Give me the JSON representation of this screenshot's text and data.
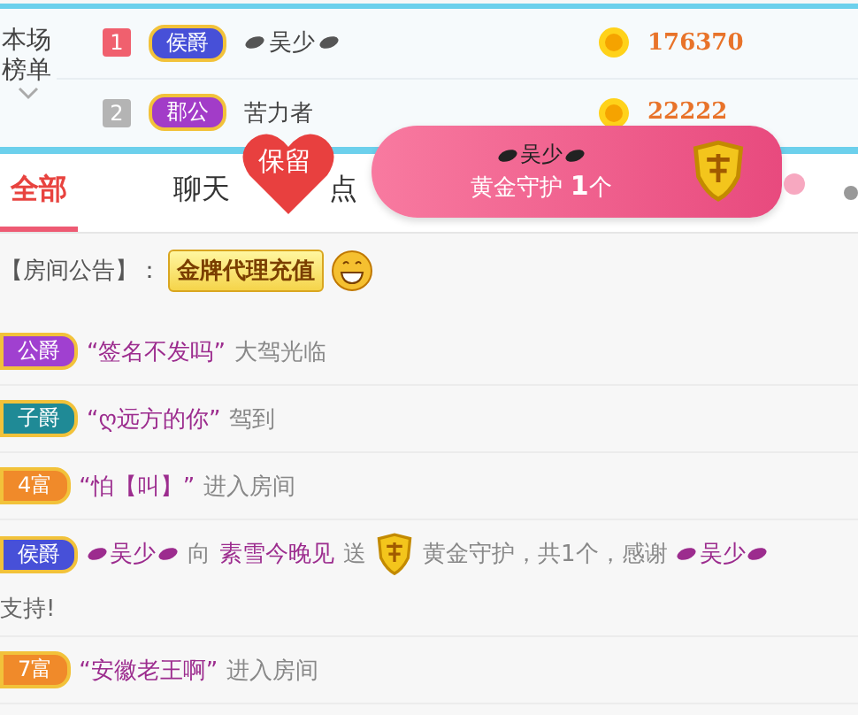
{
  "ranking": {
    "title": "本场榜单",
    "rows": [
      {
        "rank": {
          "label": "1",
          "color": "#f0606e"
        },
        "badge": {
          "label": "侯爵",
          "color": "#4750d8"
        },
        "name": "吴少",
        "lips": true,
        "score": "176370"
      },
      {
        "rank": {
          "label": "2",
          "color": "#b4b4b4"
        },
        "badge": {
          "label": "郡公",
          "color": "#a23cc8"
        },
        "name": "苦力者",
        "lips": false,
        "score": "22222"
      }
    ]
  },
  "tabs": [
    {
      "label": "全部",
      "selected": true
    },
    {
      "label": "聊天",
      "selected": false
    },
    {
      "label": "点",
      "selected": false
    }
  ],
  "keep_badge": {
    "label": "保留"
  },
  "guard_banner": {
    "name": "吴少",
    "title": "黄金守护 **1**个"
  },
  "announcement": {
    "label": "【房间公告】：",
    "badge": "金牌代理充值"
  },
  "messages": [
    {
      "kind": "entry",
      "badge": {
        "label": "公爵",
        "color": "#a040d0"
      },
      "parts": [
        {
          "kind": "user",
          "text": "“签名不发吗”"
        },
        {
          "kind": "text",
          "text": "大驾光临"
        }
      ]
    },
    {
      "kind": "entry",
      "badge": {
        "label": "子爵",
        "color": "#1f8a96"
      },
      "parts": [
        {
          "kind": "user",
          "text": "“ღ远方的你”"
        },
        {
          "kind": "text",
          "text": "驾到"
        }
      ]
    },
    {
      "kind": "entry",
      "badge": {
        "label": "4富",
        "color": "#f08a2a"
      },
      "parts": [
        {
          "kind": "user",
          "text": "“怕【叫】”"
        },
        {
          "kind": "text",
          "text": "进入房间"
        }
      ]
    },
    {
      "kind": "gift",
      "badge": {
        "label": "侯爵",
        "color": "#4750d8"
      },
      "parts": [
        {
          "kind": "user",
          "text": "吴少",
          "lips": true
        },
        {
          "kind": "text",
          "text": "向"
        },
        {
          "kind": "user",
          "text": "素雪今晚见"
        },
        {
          "kind": "text",
          "text": "送"
        },
        {
          "kind": "shield"
        },
        {
          "kind": "text",
          "text": "黄金守护，共1个，感谢"
        },
        {
          "kind": "user",
          "text": "吴少",
          "lips": true
        }
      ],
      "continuation": "支持!"
    },
    {
      "kind": "entry",
      "badge": {
        "label": "7富",
        "color": "#f08a2a"
      },
      "parts": [
        {
          "kind": "user",
          "text": "“安徽老王啊”"
        },
        {
          "kind": "text",
          "text": "进入房间"
        }
      ]
    }
  ]
}
